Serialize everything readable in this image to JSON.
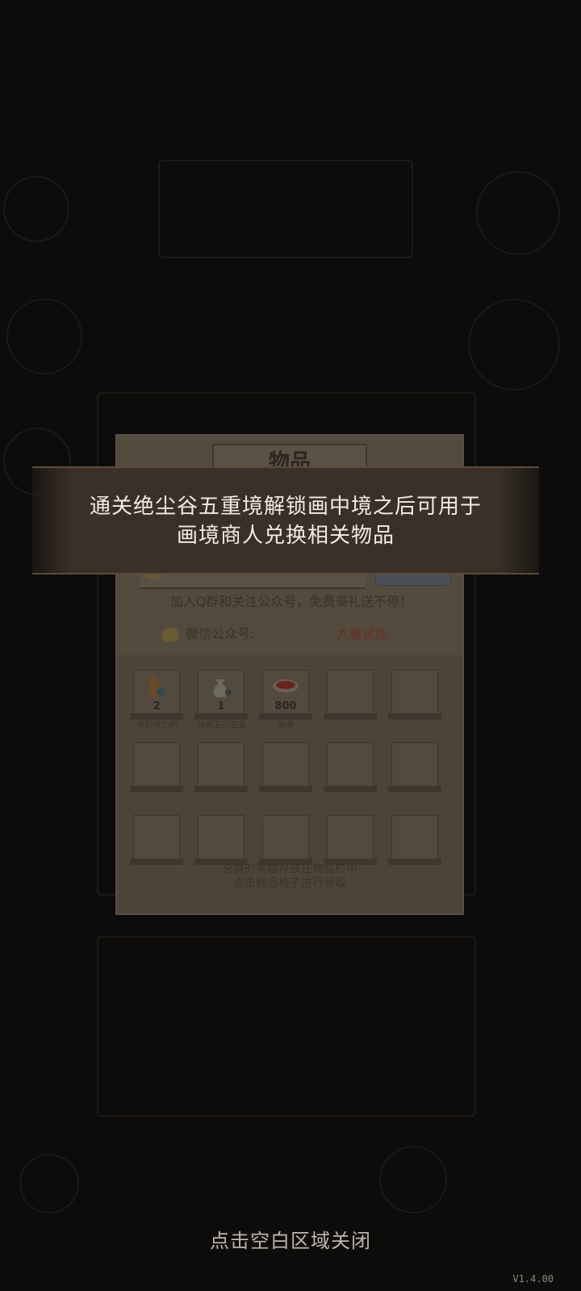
{
  "dialog": {
    "tab_label": "物品",
    "promo_text": "加入Q群和关注公众号，免费豪礼送不停！",
    "wechat_label": "微信公众号:",
    "wechat_value": "九重试炼",
    "footer_line1": "兑换的奖励存放在物品栏中",
    "footer_line2": "点击物品格子进行领取",
    "items": [
      {
        "count": "2",
        "name": "低阶体力药",
        "icon": "gourd-icon"
      },
      {
        "count": "1",
        "name": "随机五行石袋",
        "icon": "stone-bag-icon"
      },
      {
        "count": "800",
        "name": "朱墨",
        "icon": "ink-bowl-icon"
      }
    ]
  },
  "banner": {
    "line1": "通关绝尘谷五重境解锁画中境之后可用于",
    "line2": "画境商人兑换相关物品"
  },
  "close_hint": "点击空白区域关闭",
  "version": "V1.4.00"
}
